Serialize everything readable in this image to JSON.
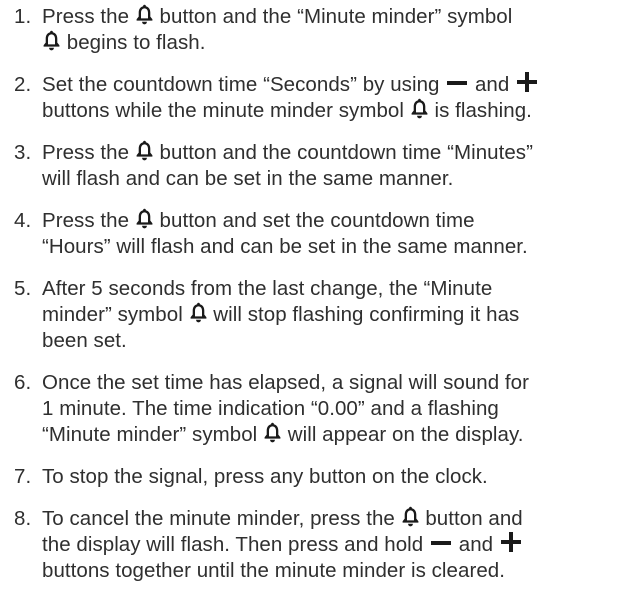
{
  "icons": {
    "bell": "minute-minder-bell-icon",
    "minus": "minus-icon",
    "plus": "plus-icon"
  },
  "colors": {
    "text": "#2f2f2f",
    "icon": "#1a1a1a"
  },
  "steps": [
    {
      "number": "1.",
      "a": "Press the ",
      "b": " button and the “Minute minder” symbol",
      "c": " begins to flash."
    },
    {
      "number": "2.",
      "a": "Set the countdown time “Seconds” by using ",
      "b": " and ",
      "c": "buttons while the minute minder symbol ",
      "d": " is flashing."
    },
    {
      "number": "3.",
      "a": "Press the ",
      "b": " button and the countdown time “Minutes”",
      "c": "will flash and can be set in the same manner."
    },
    {
      "number": "4.",
      "a": "Press the ",
      "b": " button and set the countdown time",
      "c": "“Hours” will flash and can be set in the same manner."
    },
    {
      "number": "5.",
      "a": "After 5 seconds from the last change, the “Minute",
      "b": "minder” symbol ",
      "c": " will stop flashing confirming it has",
      "d": "been set."
    },
    {
      "number": "6.",
      "a": "Once the set time has elapsed, a signal will sound for",
      "b": "1 minute. The time indication “0.00” and a flashing",
      "c": "“Minute minder” symbol ",
      "d": " will appear on the display."
    },
    {
      "number": "7.",
      "a": "To stop the signal, press any button on the clock."
    },
    {
      "number": "8.",
      "a": "To cancel the minute minder, press the ",
      "b": " button and",
      "c": "the display will flash. Then press and hold ",
      "d": " and ",
      "e": "buttons together until the minute minder is cleared."
    }
  ]
}
